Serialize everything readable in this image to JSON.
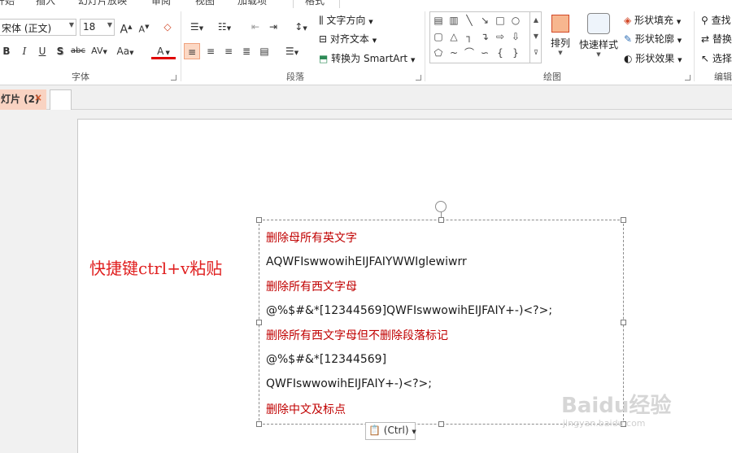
{
  "tabs": [
    "开始",
    "插入",
    "幻灯片放映",
    "审阅",
    "视图",
    "加载项",
    "格式"
  ],
  "font_group": {
    "label": "字体",
    "font_name": "宋体 (正文)",
    "font_size": "18",
    "grow": "A",
    "shrink": "A",
    "bold": "B",
    "italic": "I",
    "underline": "U",
    "shadow": "S",
    "strike": "abc",
    "spacing": "AV",
    "case": "Aa",
    "color": "A"
  },
  "paragraph_group": {
    "label": "段落",
    "text_direction": "文字方向",
    "align_text": "对齐文本",
    "smartart": "转换为 SmartArt"
  },
  "drawing_group": {
    "label": "绘图",
    "arrange": "排列",
    "quick_styles": "快速样式",
    "shape_fill": "形状填充",
    "shape_outline": "形状轮廓",
    "shape_effects": "形状效果"
  },
  "editing_group": {
    "label": "编辑",
    "find": "查找",
    "replace": "替换",
    "select": "选择"
  },
  "doc_tab": {
    "label": "灯片 (2)",
    "close": "×"
  },
  "slide": {
    "caption": "快捷键ctrl+v粘贴",
    "lines": [
      "删除母所有英文字",
      "AQWFIswwowihEIJFAIYWWIglewiwrr",
      "删除所有西文字母",
      "@%$#&*[12344569]QWFIswwowihEIJFAIY+-)<?>;",
      "删除所有西文字母但不删除段落标记",
      "@%$#&*[12344569]",
      "QWFIswwowihEIJFAIY+-)<?>;",
      "删除中文及标点"
    ],
    "paste_button": "(Ctrl)"
  },
  "watermark": {
    "brand": "Baidu经验",
    "url": "jingyan.baidu.com"
  },
  "colors": {
    "accent": "#d24726",
    "red_text": "#c00000",
    "caption": "#e02020"
  }
}
